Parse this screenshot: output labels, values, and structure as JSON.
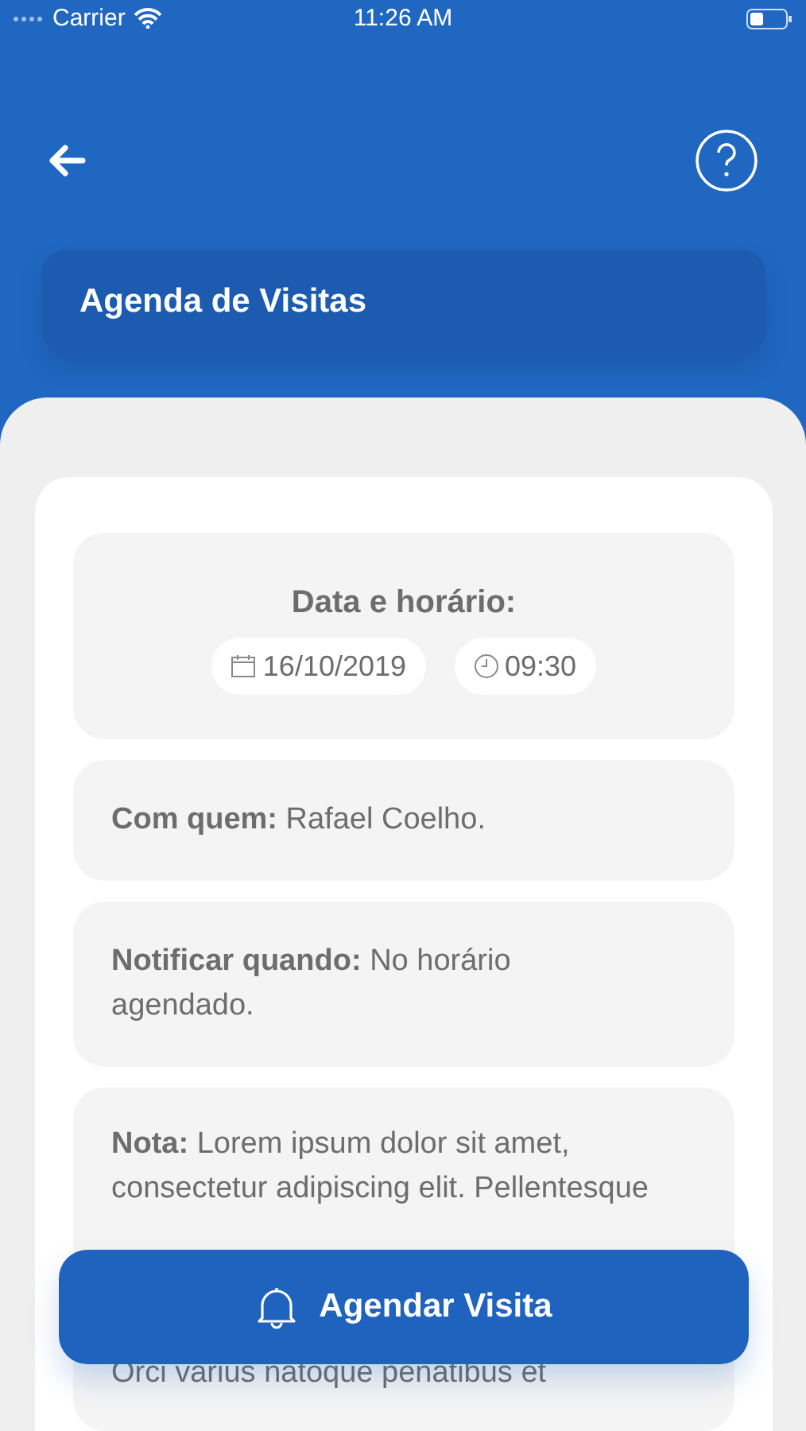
{
  "status_bar": {
    "carrier": "Carrier",
    "time": "11:26 AM"
  },
  "header": {
    "title": "Agenda de Visitas"
  },
  "schedule": {
    "label": "Data e horário:",
    "date": "16/10/2019",
    "time": "09:30"
  },
  "details": [
    {
      "label": "Com quem:",
      "value": "Rafael Coelho."
    },
    {
      "label": "Notificar quando:",
      "value": "No horário agendado."
    }
  ],
  "note": {
    "label": "Nota:",
    "text": "Lorem ipsum dolor sit amet, consectetur adipiscing elit. Pellentesque",
    "text_after": "Orci varius natoque penatibus et"
  },
  "action_button": {
    "label": "Agendar Visita"
  }
}
